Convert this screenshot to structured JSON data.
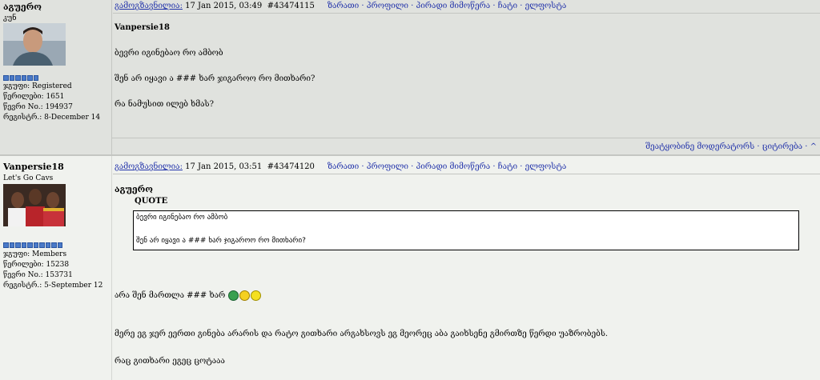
{
  "posts": [
    {
      "author": "აგუერო",
      "user_title": "კუნ",
      "group": "ჯგუფი: Registered",
      "posts_count": "წერილები: 1651",
      "member_no": "წევრი No.: 194937",
      "registered": "რეგისტრ.: 8-December 14",
      "header_link": "გამოგზავნილია:",
      "date": "17 Jan 2015, 03:49",
      "post_id": "#43474115",
      "nav": "ზარათი · პროფილი · პირადი მიმოწერა · ჩატი · ელფოსტა",
      "quoted_user": "Vanpersie18",
      "lines": [
        "ბევრი იგინებაო რო ამბობ",
        "შენ არ იყავი ა ### ხარ ჯიგაროო რო მითხარი?",
        "რა ნამუსით ილებ ხმას?"
      ],
      "footer": "შეატყობინე მოდერატორს · ციტირება · ^"
    },
    {
      "author": "Vanpersie18",
      "user_title": "Let's Go Cavs",
      "group": "ჯგუფი: Members",
      "posts_count": "წერილები: 15238",
      "member_no": "წევრი No.: 153731",
      "registered": "რეგისტრ.: 5-September 12",
      "header_link": "გამოგზავნილია:",
      "date": "17 Jan 2015, 03:51",
      "post_id": "#43474120",
      "nav": "ზარათი · პროფილი · პირადი მიმოწერა · ჩატი · ელფოსტა",
      "reply_to": "აგუერო",
      "quote_label": "QUOTE",
      "quote_lines": [
        "ბევრი იგინებაო რო ამბობ",
        "შენ არ იყავი ა ### ხარ ჯიგაროო რო მითხარი?"
      ],
      "lines": [
        "არა შენ მართლა ### ხარ",
        "მერე ეგ ჯერ ეერთი გინება არარის და რატო გითხარი არგახსოვს ეგ მეორეც აბა გაიხსენე გმირთზე წერდი უაზრობებს.",
        "რაც გითხარი ეგეც ცოტააა"
      ]
    }
  ],
  "colors": {
    "link": "#2233aa",
    "post1_bg": "#e0e2de",
    "post2_bg": "#f0f2ee",
    "pip": "#4a7ac8"
  },
  "icons": [
    "avatar-photo",
    "rank-pips",
    "grin-smiley-icon",
    "laugh-smiley-icon"
  ]
}
